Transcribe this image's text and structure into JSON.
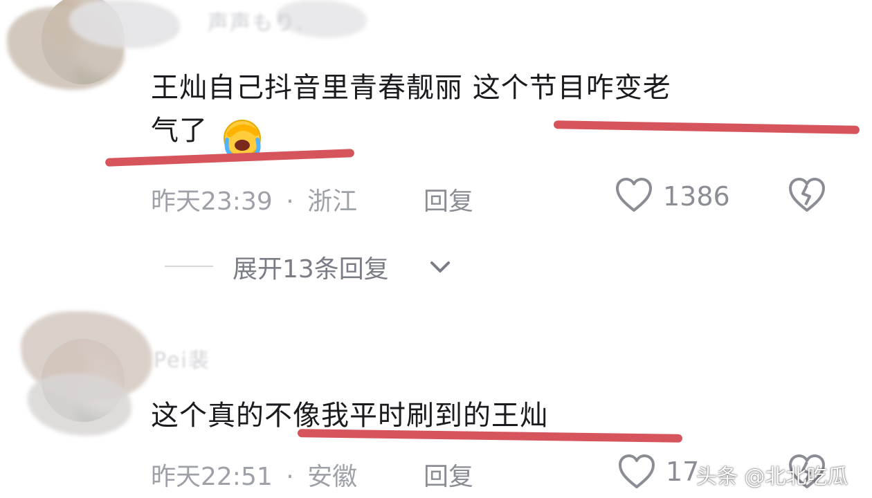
{
  "comments": [
    {
      "text_line1": "王灿自己抖音里青春靓丽 这个节目咋变老",
      "text_line2": "气了",
      "emoji": "facepalm-cry-emoji",
      "time": "昨天23:39",
      "location": "浙江",
      "separator": "·",
      "reply_label": "回复",
      "likes": "1386"
    },
    {
      "username_partial": "Pei裴",
      "text": "这个真的不像我平时刷到的王灿",
      "time": "昨天22:51",
      "location": "安徽",
      "separator": "·",
      "reply_label": "回复",
      "likes": "17"
    }
  ],
  "expand_replies": {
    "label": "展开13条回复"
  },
  "watermark": "头条 @北北吃瓜",
  "colors": {
    "underline": "#d6555d",
    "text": "#1b1b1f",
    "meta": "#9ea1a8"
  }
}
